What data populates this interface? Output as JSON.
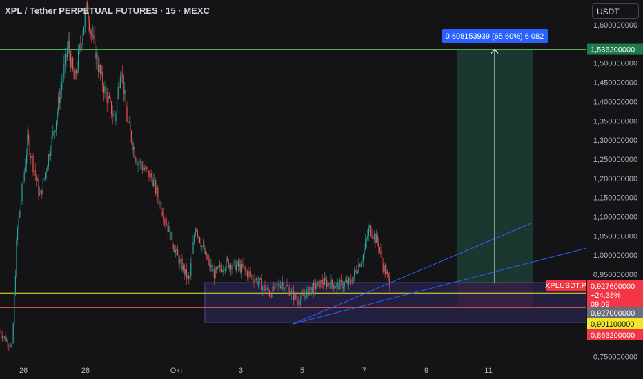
{
  "header": {
    "title": "XPL / Tether PERPETUAL FUTURES · 15 · MEXC",
    "currency": "USDT"
  },
  "chart_data": {
    "type": "candlestick",
    "symbol": "XPLUSDT.P",
    "x_ticks": [
      "26",
      "28",
      "Окт",
      "3",
      "5",
      "7",
      "9",
      "11"
    ],
    "y_ticks": [
      "1,600000000",
      "1,500000000",
      "1,450000000",
      "1,400000000",
      "1,350000000",
      "1,300000000",
      "1,250000000",
      "1,200000000",
      "1,150000000",
      "1,100000000",
      "1,050000000",
      "1,000000000",
      "0,950000000",
      "0,750000000"
    ],
    "y_tick_values": [
      1.6,
      1.5,
      1.45,
      1.4,
      1.35,
      1.3,
      1.25,
      1.2,
      1.15,
      1.1,
      1.05,
      1.0,
      0.95,
      0.75
    ],
    "price_path_approx": [
      [
        0,
        0.8
      ],
      [
        0.4,
        0.76
      ],
      [
        0.55,
        1.05
      ],
      [
        0.9,
        1.3
      ],
      [
        1.3,
        1.15
      ],
      [
        1.8,
        1.35
      ],
      [
        2.2,
        1.55
      ],
      [
        2.4,
        1.45
      ],
      [
        2.8,
        1.65
      ],
      [
        3.0,
        1.55
      ],
      [
        3.3,
        1.45
      ],
      [
        3.7,
        1.35
      ],
      [
        3.9,
        1.5
      ],
      [
        4.1,
        1.35
      ],
      [
        4.4,
        1.25
      ],
      [
        4.9,
        1.2
      ],
      [
        5.3,
        1.1
      ],
      [
        5.7,
        1.0
      ],
      [
        6.1,
        0.93
      ],
      [
        6.3,
        1.08
      ],
      [
        6.6,
        1.0
      ],
      [
        6.9,
        0.95
      ],
      [
        7.3,
        0.98
      ],
      [
        7.7,
        0.97
      ],
      [
        8.2,
        0.94
      ],
      [
        8.7,
        0.9
      ],
      [
        9.1,
        0.93
      ],
      [
        9.6,
        0.88
      ],
      [
        10.0,
        0.91
      ],
      [
        10.4,
        0.93
      ],
      [
        10.9,
        0.92
      ],
      [
        11.3,
        0.93
      ],
      [
        11.7,
        1.0
      ],
      [
        11.9,
        1.07
      ],
      [
        12.2,
        1.03
      ],
      [
        12.3,
        0.98
      ],
      [
        12.55,
        0.93
      ]
    ],
    "labels": {
      "measure": "0,608153939 (65,60%) 6 082",
      "target": "1,536200000",
      "symbol_tag": "XPLUSDT.P",
      "last_price": "0,927600000",
      "change": "+24,38%",
      "countdown": "09:09",
      "level_gray": "0,927000000",
      "level_yellow": "0,901100000",
      "level_red": "0,863200000"
    },
    "levels": {
      "target": 1.5362,
      "entry": 0.9276,
      "yellow": 0.9011,
      "red": 0.8632,
      "box_top": 0.93,
      "box_bottom": 0.83
    }
  },
  "colors": {
    "up": "#26a69a",
    "down": "#ef5350",
    "bg": "#141417",
    "green_line": "#4caf50",
    "yellow": "#f0e62a",
    "blue": "#2962ff",
    "measure": "#2962ff"
  }
}
